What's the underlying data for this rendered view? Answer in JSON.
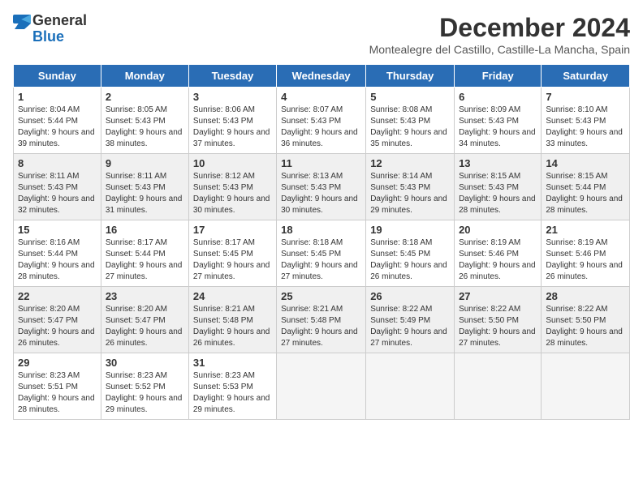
{
  "logo": {
    "text_general": "General",
    "text_blue": "Blue"
  },
  "header": {
    "month_year": "December 2024",
    "location": "Montealegre del Castillo, Castille-La Mancha, Spain"
  },
  "days_of_week": [
    "Sunday",
    "Monday",
    "Tuesday",
    "Wednesday",
    "Thursday",
    "Friday",
    "Saturday"
  ],
  "weeks": [
    {
      "shaded": false,
      "days": [
        {
          "num": "1",
          "sunrise": "8:04 AM",
          "sunset": "5:44 PM",
          "daylight": "9 hours and 39 minutes."
        },
        {
          "num": "2",
          "sunrise": "8:05 AM",
          "sunset": "5:43 PM",
          "daylight": "9 hours and 38 minutes."
        },
        {
          "num": "3",
          "sunrise": "8:06 AM",
          "sunset": "5:43 PM",
          "daylight": "9 hours and 37 minutes."
        },
        {
          "num": "4",
          "sunrise": "8:07 AM",
          "sunset": "5:43 PM",
          "daylight": "9 hours and 36 minutes."
        },
        {
          "num": "5",
          "sunrise": "8:08 AM",
          "sunset": "5:43 PM",
          "daylight": "9 hours and 35 minutes."
        },
        {
          "num": "6",
          "sunrise": "8:09 AM",
          "sunset": "5:43 PM",
          "daylight": "9 hours and 34 minutes."
        },
        {
          "num": "7",
          "sunrise": "8:10 AM",
          "sunset": "5:43 PM",
          "daylight": "9 hours and 33 minutes."
        }
      ]
    },
    {
      "shaded": true,
      "days": [
        {
          "num": "8",
          "sunrise": "8:11 AM",
          "sunset": "5:43 PM",
          "daylight": "9 hours and 32 minutes."
        },
        {
          "num": "9",
          "sunrise": "8:11 AM",
          "sunset": "5:43 PM",
          "daylight": "9 hours and 31 minutes."
        },
        {
          "num": "10",
          "sunrise": "8:12 AM",
          "sunset": "5:43 PM",
          "daylight": "9 hours and 30 minutes."
        },
        {
          "num": "11",
          "sunrise": "8:13 AM",
          "sunset": "5:43 PM",
          "daylight": "9 hours and 30 minutes."
        },
        {
          "num": "12",
          "sunrise": "8:14 AM",
          "sunset": "5:43 PM",
          "daylight": "9 hours and 29 minutes."
        },
        {
          "num": "13",
          "sunrise": "8:15 AM",
          "sunset": "5:43 PM",
          "daylight": "9 hours and 28 minutes."
        },
        {
          "num": "14",
          "sunrise": "8:15 AM",
          "sunset": "5:44 PM",
          "daylight": "9 hours and 28 minutes."
        }
      ]
    },
    {
      "shaded": false,
      "days": [
        {
          "num": "15",
          "sunrise": "8:16 AM",
          "sunset": "5:44 PM",
          "daylight": "9 hours and 28 minutes."
        },
        {
          "num": "16",
          "sunrise": "8:17 AM",
          "sunset": "5:44 PM",
          "daylight": "9 hours and 27 minutes."
        },
        {
          "num": "17",
          "sunrise": "8:17 AM",
          "sunset": "5:45 PM",
          "daylight": "9 hours and 27 minutes."
        },
        {
          "num": "18",
          "sunrise": "8:18 AM",
          "sunset": "5:45 PM",
          "daylight": "9 hours and 27 minutes."
        },
        {
          "num": "19",
          "sunrise": "8:18 AM",
          "sunset": "5:45 PM",
          "daylight": "9 hours and 26 minutes."
        },
        {
          "num": "20",
          "sunrise": "8:19 AM",
          "sunset": "5:46 PM",
          "daylight": "9 hours and 26 minutes."
        },
        {
          "num": "21",
          "sunrise": "8:19 AM",
          "sunset": "5:46 PM",
          "daylight": "9 hours and 26 minutes."
        }
      ]
    },
    {
      "shaded": true,
      "days": [
        {
          "num": "22",
          "sunrise": "8:20 AM",
          "sunset": "5:47 PM",
          "daylight": "9 hours and 26 minutes."
        },
        {
          "num": "23",
          "sunrise": "8:20 AM",
          "sunset": "5:47 PM",
          "daylight": "9 hours and 26 minutes."
        },
        {
          "num": "24",
          "sunrise": "8:21 AM",
          "sunset": "5:48 PM",
          "daylight": "9 hours and 26 minutes."
        },
        {
          "num": "25",
          "sunrise": "8:21 AM",
          "sunset": "5:48 PM",
          "daylight": "9 hours and 27 minutes."
        },
        {
          "num": "26",
          "sunrise": "8:22 AM",
          "sunset": "5:49 PM",
          "daylight": "9 hours and 27 minutes."
        },
        {
          "num": "27",
          "sunrise": "8:22 AM",
          "sunset": "5:50 PM",
          "daylight": "9 hours and 27 minutes."
        },
        {
          "num": "28",
          "sunrise": "8:22 AM",
          "sunset": "5:50 PM",
          "daylight": "9 hours and 28 minutes."
        }
      ]
    },
    {
      "shaded": false,
      "days": [
        {
          "num": "29",
          "sunrise": "8:23 AM",
          "sunset": "5:51 PM",
          "daylight": "9 hours and 28 minutes."
        },
        {
          "num": "30",
          "sunrise": "8:23 AM",
          "sunset": "5:52 PM",
          "daylight": "9 hours and 29 minutes."
        },
        {
          "num": "31",
          "sunrise": "8:23 AM",
          "sunset": "5:53 PM",
          "daylight": "9 hours and 29 minutes."
        },
        null,
        null,
        null,
        null
      ]
    }
  ]
}
